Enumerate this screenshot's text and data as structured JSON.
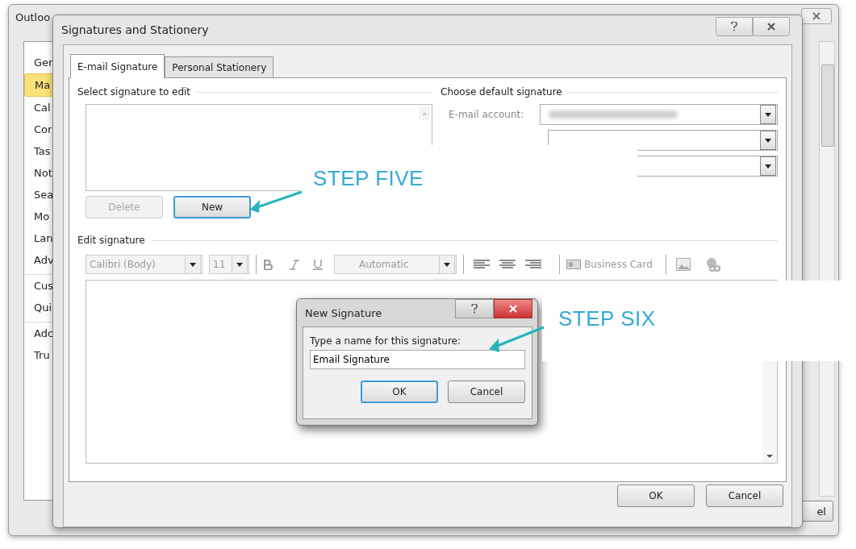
{
  "outlook_window": {
    "title": "Outloo",
    "nav_items": [
      {
        "label": "Ger",
        "selected": false,
        "group_start": false
      },
      {
        "label": "Ma",
        "selected": true,
        "group_start": false
      },
      {
        "label": "Cal",
        "selected": false,
        "group_start": false
      },
      {
        "label": "Cor",
        "selected": false,
        "group_start": false
      },
      {
        "label": "Tas",
        "selected": false,
        "group_start": false
      },
      {
        "label": "Not",
        "selected": false,
        "group_start": false
      },
      {
        "label": "Sea",
        "selected": false,
        "group_start": false
      },
      {
        "label": "Mo",
        "selected": false,
        "group_start": false
      },
      {
        "label": "Lan",
        "selected": false,
        "group_start": false
      },
      {
        "label": "Adv",
        "selected": false,
        "group_start": false
      },
      {
        "label": "Cus",
        "selected": false,
        "group_start": true
      },
      {
        "label": "Qui",
        "selected": false,
        "group_start": false
      },
      {
        "label": "Adc",
        "selected": false,
        "group_start": true
      },
      {
        "label": "Tru",
        "selected": false,
        "group_start": false
      }
    ],
    "partial_button": "el"
  },
  "signatures_dialog": {
    "title": "Signatures and Stationery",
    "tabs": [
      {
        "label": "E-mail Signature",
        "selected": true
      },
      {
        "label": "Personal Stationery",
        "selected": false
      }
    ],
    "select_label": "Select signature to edit",
    "list_buttons": [
      {
        "label": "Delete",
        "disabled": true,
        "focused": false
      },
      {
        "label": "New",
        "disabled": false,
        "focused": true
      }
    ],
    "default_title": "Choose default signature",
    "email_account_label": "E-mail account:",
    "edit_label": "Edit signature",
    "toolbar": {
      "font": "Calibri (Body)",
      "size": "11",
      "color_picker": "Automatic",
      "business_card": "Business Card"
    },
    "buttons": [
      "OK",
      "Cancel"
    ]
  },
  "new_signature_dialog": {
    "title": "New Signature",
    "prompt": "Type a name for this signature:",
    "value": "Email Signature",
    "buttons": [
      {
        "label": "OK",
        "focused": true
      },
      {
        "label": "Cancel",
        "focused": false
      }
    ]
  },
  "annotations": [
    {
      "text": "STEP FIVE"
    },
    {
      "text": "STEP SIX"
    }
  ]
}
